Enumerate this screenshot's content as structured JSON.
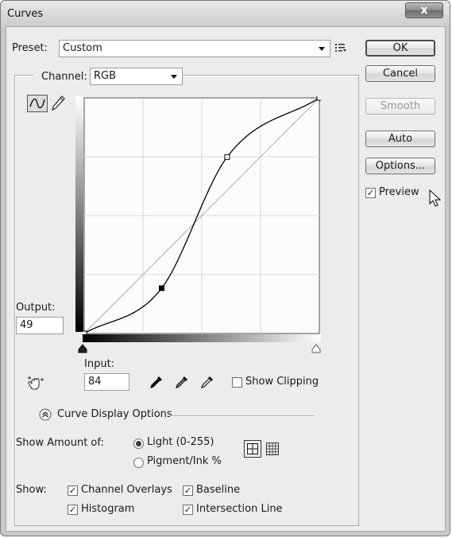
{
  "window": {
    "title": "Curves",
    "close_glyph": "x"
  },
  "preset": {
    "label": "Preset:",
    "value": "Custom",
    "menu_icon": "preset-options-icon"
  },
  "channel": {
    "label": "Channel:",
    "value": "RGB"
  },
  "buttons": {
    "ok": "OK",
    "cancel": "Cancel",
    "smooth": "Smooth",
    "auto": "Auto",
    "options": "Options..."
  },
  "preview": {
    "label": "Preview",
    "checked": true
  },
  "curve_tools": {
    "point_tool": "curve-point-icon",
    "pencil_tool": "pencil-icon"
  },
  "output": {
    "label": "Output:",
    "value": "49"
  },
  "input": {
    "label": "Input:",
    "value": "84"
  },
  "eyedroppers": [
    "black-point-eyedropper-icon",
    "gray-point-eyedropper-icon",
    "white-point-eyedropper-icon"
  ],
  "show_clipping": {
    "label": "Show Clipping",
    "checked": false
  },
  "curve_display_options": {
    "label": "Curve Display Options"
  },
  "show_amount": {
    "label": "Show Amount of:",
    "options": [
      {
        "label": "Light  (0-255)",
        "selected": true
      },
      {
        "label": "Pigment/Ink %",
        "selected": false
      }
    ]
  },
  "show": {
    "label": "Show:",
    "items": [
      {
        "label": "Channel Overlays",
        "checked": true
      },
      {
        "label": "Baseline",
        "checked": true
      },
      {
        "label": "Histogram",
        "checked": true
      },
      {
        "label": "Intersection Line",
        "checked": true
      }
    ]
  },
  "curve": {
    "range": [
      0,
      255
    ],
    "control_points": [
      {
        "input": 0,
        "output": 0
      },
      {
        "input": 84,
        "output": 49
      },
      {
        "input": 155,
        "output": 191
      },
      {
        "input": 255,
        "output": 255
      }
    ],
    "selected_point_index": 1
  },
  "colors": {
    "dialog_bg": "#ececec",
    "graph_bg": "#fcfcfc",
    "grid": "#d8d8d8",
    "curve": "#000000",
    "baseline": "#b0b0b0"
  }
}
